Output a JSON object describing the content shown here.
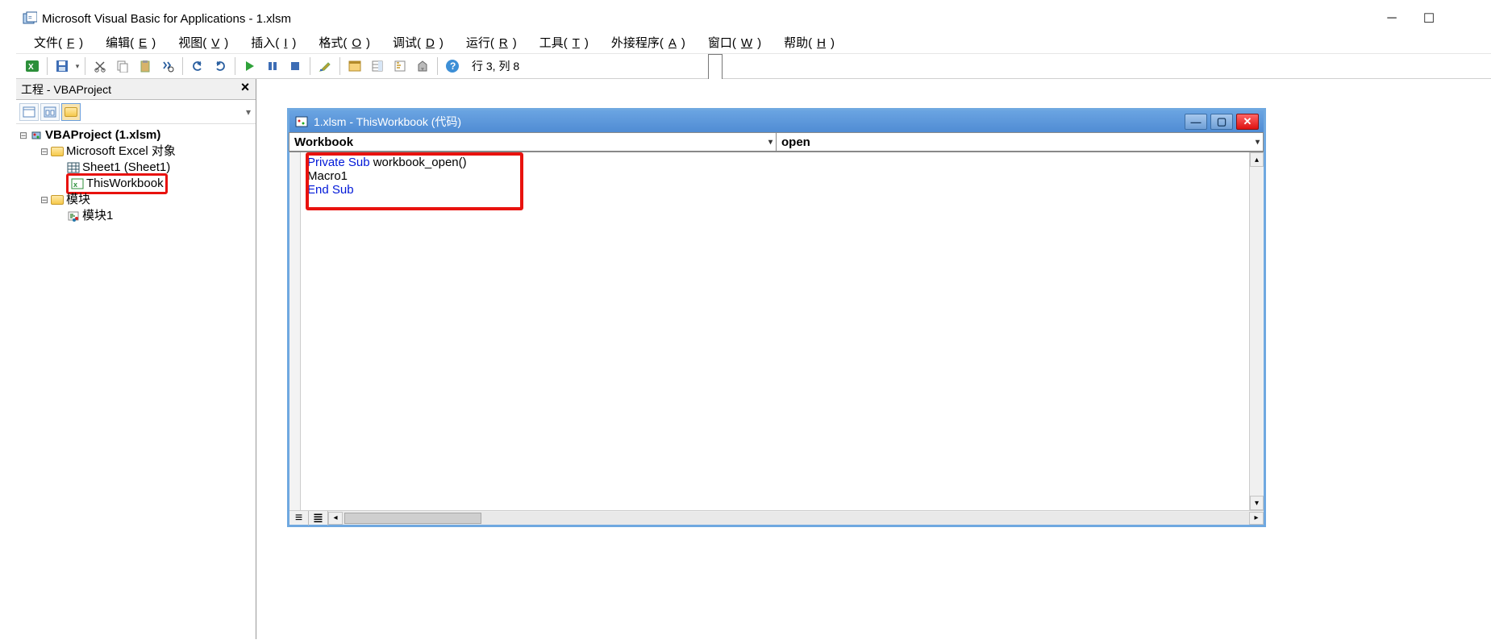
{
  "app": {
    "title": "Microsoft Visual Basic for Applications - 1.xlsm"
  },
  "menu": {
    "file": {
      "pre": "文件(",
      "key": "F",
      "post": ")"
    },
    "edit": {
      "pre": "编辑(",
      "key": "E",
      "post": ")"
    },
    "view": {
      "pre": "视图(",
      "key": "V",
      "post": ")"
    },
    "insert": {
      "pre": "插入(",
      "key": "I",
      "post": ")"
    },
    "format": {
      "pre": "格式(",
      "key": "O",
      "post": ")"
    },
    "debug": {
      "pre": "调试(",
      "key": "D",
      "post": ")"
    },
    "run": {
      "pre": "运行(",
      "key": "R",
      "post": ")"
    },
    "tools": {
      "pre": "工具(",
      "key": "T",
      "post": ")"
    },
    "addins": {
      "pre": "外接程序(",
      "key": "A",
      "post": ")"
    },
    "window": {
      "pre": "窗口(",
      "key": "W",
      "post": ")"
    },
    "help": {
      "pre": "帮助(",
      "key": "H",
      "post": ")"
    }
  },
  "toolbar": {
    "status": "行 3, 列 8"
  },
  "project_pane": {
    "title": "工程 - VBAProject",
    "root": "VBAProject (1.xlsm)",
    "excel_objects": "Microsoft Excel 对象",
    "sheet1": "Sheet1 (Sheet1)",
    "thisworkbook": "ThisWorkbook",
    "modules": "模块",
    "module1": "模块1"
  },
  "code_window": {
    "title": "1.xlsm - ThisWorkbook (代码)",
    "object_combo": "Workbook",
    "proc_combo": "open",
    "code_kw1": "Private Sub",
    "code_mid1": " workbook_open()",
    "code_line2": "Macro1",
    "code_kw2": "End Sub"
  }
}
